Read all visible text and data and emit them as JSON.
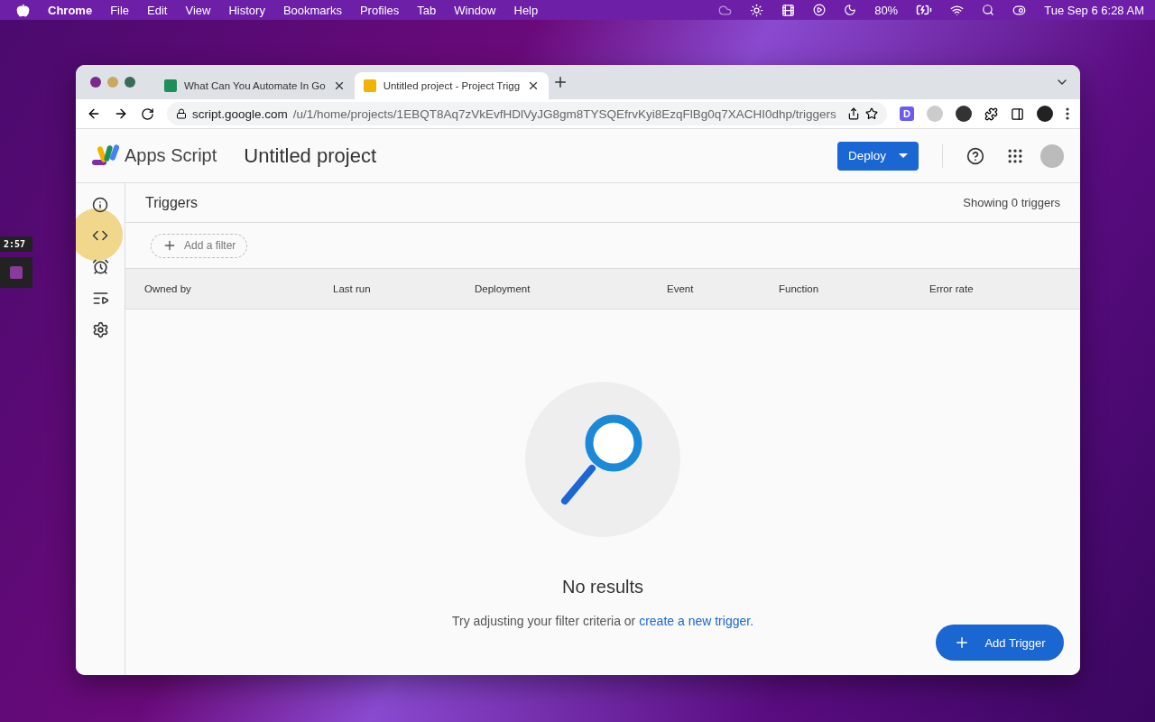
{
  "menubar": {
    "app": "Chrome",
    "items": [
      "File",
      "Edit",
      "View",
      "History",
      "Bookmarks",
      "Profiles",
      "Tab",
      "Window",
      "Help"
    ],
    "battery": "80%",
    "clock": "Tue Sep 6  6:28 AM"
  },
  "timer": "2:57",
  "browser": {
    "tabs": [
      {
        "title": "What Can You Automate In Go",
        "selected": false
      },
      {
        "title": "Untitled project - Project Trigg",
        "selected": true
      }
    ],
    "url_host": "script.google.com",
    "url_path": "/u/1/home/projects/1EBQT8Aq7zVkEvfHDlVyJG8gm8TYSQEfrvKyi8EzqFlBg0q7XACHI0dhp/triggers",
    "extension_letter": "D"
  },
  "header": {
    "product": "Apps Script",
    "project": "Untitled project",
    "deploy": "Deploy"
  },
  "sidebar": [
    {
      "kind": "overview"
    },
    {
      "kind": "editor"
    },
    {
      "kind": "triggers"
    },
    {
      "kind": "executions"
    },
    {
      "kind": "settings"
    }
  ],
  "page": {
    "title": "Triggers",
    "count": "Showing 0 triggers",
    "filter": "Add a filter",
    "columns": [
      "Owned by",
      "Last run",
      "Deployment",
      "Event",
      "Function",
      "Error rate"
    ],
    "empty_title": "No results",
    "empty_text": "Try adjusting your filter criteria or ",
    "empty_link": "create a new trigger.",
    "fab": "Add Trigger"
  }
}
